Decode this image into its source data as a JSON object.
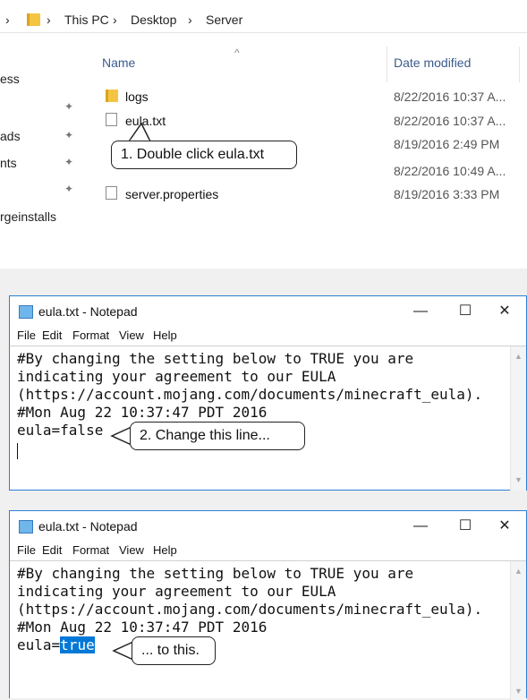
{
  "explorer": {
    "breadcrumb": [
      "This PC",
      "Desktop",
      "Server"
    ],
    "columns": {
      "name": "Name",
      "date": "Date modified"
    },
    "sidebar": [
      "ess",
      "ads",
      "nts",
      "rgeinstalls"
    ],
    "files": [
      {
        "name": "logs",
        "date": "8/22/2016 10:37 A...",
        "type": "folder"
      },
      {
        "name": "eula.txt",
        "date": "8/22/2016 10:37 A...",
        "type": "text"
      },
      {
        "name": "",
        "date": "8/19/2016 2:49 PM",
        "type": "hidden"
      },
      {
        "name": "",
        "date": "8/22/2016 10:49 A...",
        "type": "hidden"
      },
      {
        "name": "server.properties",
        "date": "8/19/2016 3:33 PM",
        "type": "text"
      }
    ],
    "callout": "1. Double click eula.txt"
  },
  "notepad1": {
    "title": "eula.txt - Notepad",
    "menu": [
      "File",
      "Edit",
      "Format",
      "View",
      "Help"
    ],
    "lines": [
      "#By changing the setting below to TRUE you are",
      "indicating your agreement to our EULA",
      "(https://account.mojang.com/documents/minecraft_eula).",
      "#Mon Aug 22 10:37:47 PDT 2016",
      "eula=false"
    ],
    "callout": "2. Change this line..."
  },
  "notepad2": {
    "title": "eula.txt - Notepad",
    "menu": [
      "File",
      "Edit",
      "Format",
      "View",
      "Help"
    ],
    "lines": [
      "#By changing the setting below to TRUE you are",
      "indicating your agreement to our EULA",
      "(https://account.mojang.com/documents/minecraft_eula).",
      "#Mon Aug 22 10:37:47 PDT 2016"
    ],
    "last_line_prefix": "eula=",
    "last_line_selected": "true",
    "callout": "... to this."
  },
  "window_buttons": {
    "minimize": "—",
    "maximize": "☐",
    "close": "✕"
  },
  "colors": {
    "accent": "#0078d7",
    "border": "#2b7fd6"
  }
}
